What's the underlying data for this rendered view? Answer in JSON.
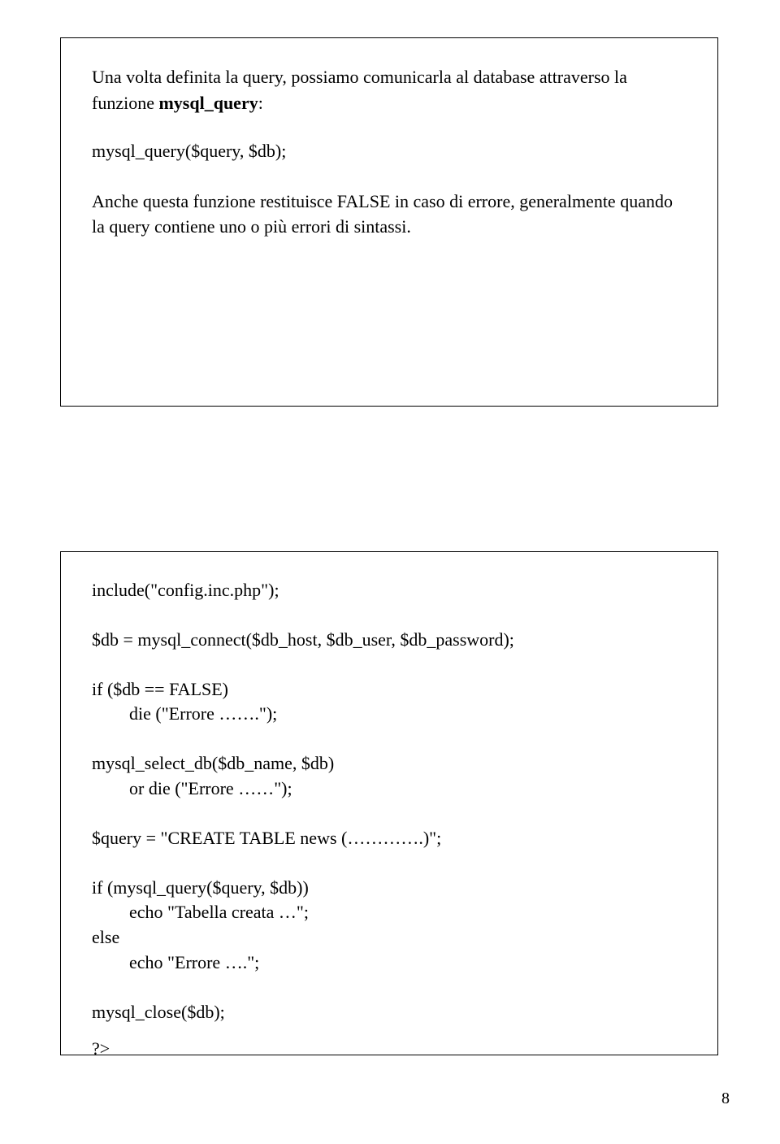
{
  "box1": {
    "p1a": "Una volta definita la query, possiamo comunicarla al database attraverso la funzione ",
    "p1b": "mysql_query",
    "p1c": ":",
    "code": "mysql_query($query, $db);",
    "p2": "Anche questa funzione restituisce FALSE in caso di errore, generalmente quando la query contiene uno o più errori di sintassi."
  },
  "box2": {
    "l1": "include(\"config.inc.php\");",
    "l2": "$db = mysql_connect($db_host, $db_user, $db_password);",
    "l3": "if ($db == FALSE)",
    "l3i": "die (\"Errore …….\");",
    "l4": "mysql_select_db($db_name, $db)",
    "l4i": "or die (\"Errore ……\");",
    "l5": "$query = \"CREATE TABLE news (………….)\";",
    "l6": "if (mysql_query($query, $db))",
    "l6i": "echo \"Tabella creata …\";",
    "l7": "else",
    "l7i": "echo \"Errore ….\";",
    "l8": "mysql_close($db);",
    "l9": "?>"
  },
  "pagenum": "8"
}
